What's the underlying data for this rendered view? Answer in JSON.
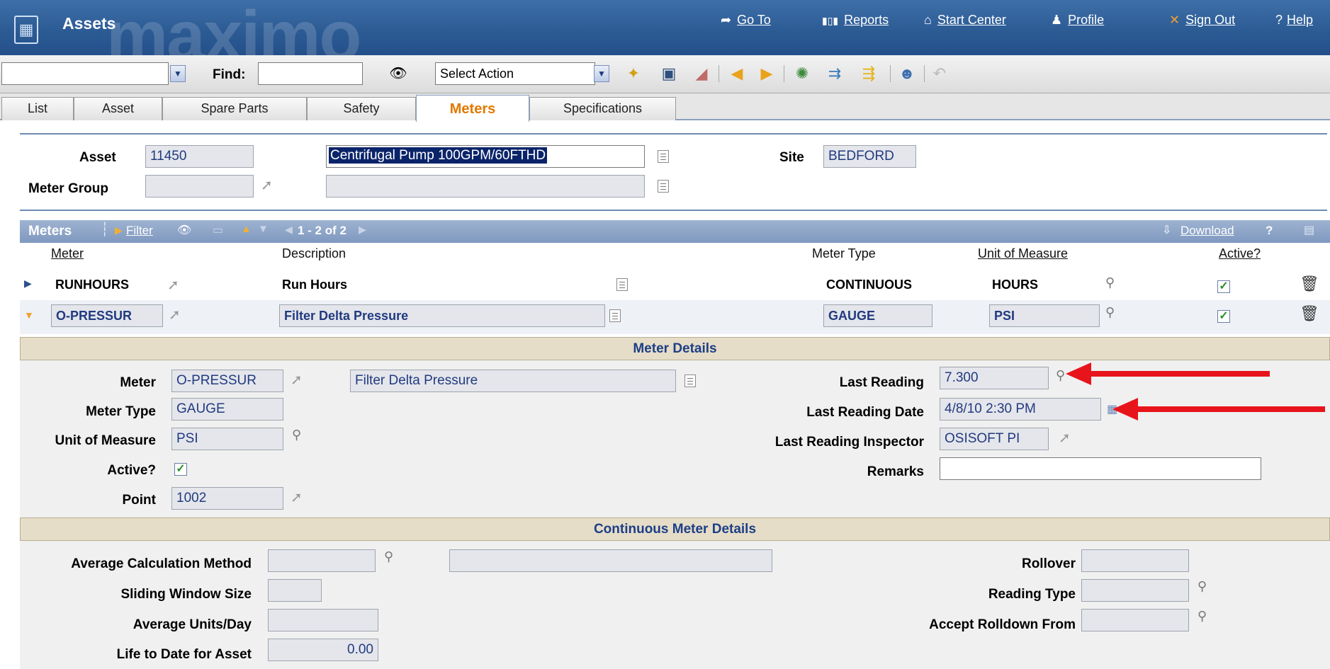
{
  "header": {
    "app_title": "Assets",
    "logo_text": "maximo",
    "nav": [
      {
        "label": "Go To",
        "icon": "go-to-icon"
      },
      {
        "label": "Reports",
        "icon": "reports-icon"
      },
      {
        "label": "Start Center",
        "icon": "home-icon"
      },
      {
        "label": "Profile",
        "icon": "profile-icon"
      },
      {
        "label": "Sign Out",
        "icon": "sign-out-icon"
      },
      {
        "label": "Help",
        "icon": "help-icon"
      }
    ]
  },
  "toolbar": {
    "query_value": "",
    "find_label": "Find:",
    "find_value": "",
    "select_action": "Select Action"
  },
  "tabs": [
    "List",
    "Asset",
    "Spare Parts",
    "Safety",
    "Meters",
    "Specifications"
  ],
  "active_tab": "Meters",
  "asset_header": {
    "asset_label": "Asset",
    "asset_value": "11450",
    "asset_description": "Centrifugal Pump 100GPM/60FTHD",
    "meter_group_label": "Meter Group",
    "meter_group_value": "",
    "meter_group_description": "",
    "site_label": "Site",
    "site_value": "BEDFORD"
  },
  "meters_table": {
    "title": "Meters",
    "filter_label": "Filter",
    "pagination": "1 - 2 of 2",
    "download_label": "Download",
    "help_label": "?",
    "columns": [
      "Meter",
      "Description",
      "Meter Type",
      "Unit of Measure",
      "Active?"
    ],
    "rows": [
      {
        "meter": "RUNHOURS",
        "description": "Run Hours",
        "meter_type": "CONTINUOUS",
        "unit": "HOURS",
        "active": true
      },
      {
        "meter": "O-PRESSUR",
        "description": "Filter Delta Pressure",
        "meter_type": "GAUGE",
        "unit": "PSI",
        "active": true
      }
    ]
  },
  "meter_details": {
    "section_title": "Meter Details",
    "meter_label": "Meter",
    "meter_value": "O-PRESSUR",
    "meter_description": "Filter Delta Pressure",
    "meter_type_label": "Meter Type",
    "meter_type_value": "GAUGE",
    "unit_label": "Unit of Measure",
    "unit_value": "PSI",
    "active_label": "Active?",
    "active": true,
    "point_label": "Point",
    "point_value": "1002",
    "last_reading_label": "Last Reading",
    "last_reading_value": "7.300",
    "last_reading_date_label": "Last Reading Date",
    "last_reading_date_value": "4/8/10 2:30 PM",
    "last_reading_inspector_label": "Last Reading Inspector",
    "last_reading_inspector_value": "OSISOFT PI",
    "remarks_label": "Remarks",
    "remarks_value": ""
  },
  "continuous_details": {
    "section_title": "Continuous Meter Details",
    "avg_calc_method_label": "Average Calculation Method",
    "avg_calc_method_value": "",
    "avg_calc_method_description": "",
    "sliding_window_label": "Sliding Window Size",
    "sliding_window_value": "",
    "avg_units_label": "Average Units/Day",
    "avg_units_value": "",
    "ltd_label": "Life to Date for Asset",
    "ltd_value": "0.00",
    "rollover_label": "Rollover",
    "rollover_value": "",
    "reading_type_label": "Reading Type",
    "reading_type_value": "",
    "accept_rolldown_label": "Accept Rolldown From",
    "accept_rolldown_value": ""
  },
  "colors": {
    "header_blue": "#2b5a93",
    "active_tab_orange": "#e07a00",
    "section_header_bg": "#e6ddc8",
    "annotation_red": "#e8141b"
  }
}
